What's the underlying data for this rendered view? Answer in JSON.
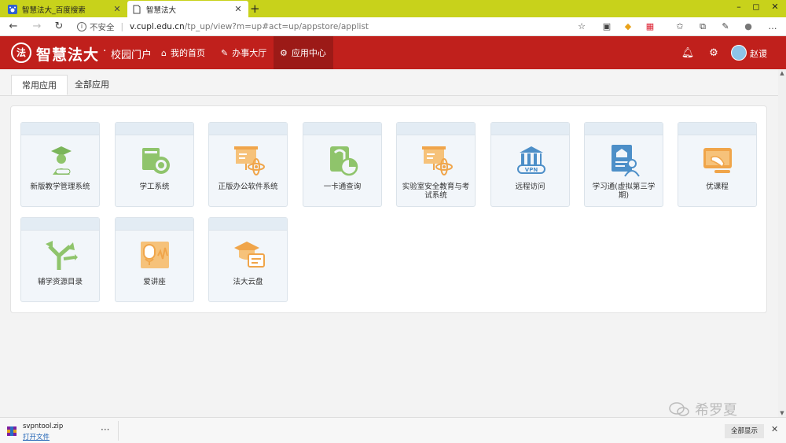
{
  "browser": {
    "tabs": [
      {
        "title": "智慧法大_百度搜索"
      },
      {
        "title": "智慧法大"
      }
    ],
    "new_tab_label": "+",
    "window_controls": {
      "minimize": "–",
      "maximize": "◻",
      "close": "✕"
    },
    "security_label": "不安全",
    "url_host": "v.cupl.edu.cn",
    "url_path": "/tp_up/view?m=up#act=up/appstore/applist"
  },
  "header": {
    "logo_glyph": "法",
    "brand": "智慧法大",
    "dot": "·",
    "subtitle": "校园门户",
    "nav": [
      {
        "label": "我的首页",
        "icon": "home-icon"
      },
      {
        "label": "办事大厅",
        "icon": "edit-icon"
      },
      {
        "label": "应用中心",
        "icon": "apps-icon"
      }
    ],
    "username": "赵谡"
  },
  "tabs": {
    "common": "常用应用",
    "all": "全部应用"
  },
  "apps": [
    {
      "label": "新版教学管理系统",
      "icon": "graduate-icon"
    },
    {
      "label": "学工系统",
      "icon": "student-affairs-icon"
    },
    {
      "label": "正版办公软件系统",
      "icon": "presentation-atom-icon"
    },
    {
      "label": "一卡通查询",
      "icon": "card-query-icon"
    },
    {
      "label": "实验室安全教育与考试系统",
      "icon": "lab-safety-icon"
    },
    {
      "label": "远程访问",
      "icon": "vpn-icon"
    },
    {
      "label": "学习通(虚拟第三学期)",
      "icon": "learning-icon"
    },
    {
      "label": "优课程",
      "icon": "course-icon"
    },
    {
      "label": "辅学资源目录",
      "icon": "directions-icon"
    },
    {
      "label": "爱讲座",
      "icon": "lecture-icon"
    },
    {
      "label": "法大云盘",
      "icon": "cloud-disk-icon"
    }
  ],
  "watermark": "希罗夏",
  "downloads": {
    "file_name": "svpntool.zip",
    "open_label": "打开文件",
    "more_label": "···",
    "show_all": "全部显示",
    "close": "✕"
  },
  "colors": {
    "accent": "#c0201c",
    "accent_dark": "#9c1a17",
    "tabstrip": "#c8d21b",
    "icon_green": "#8fc46b",
    "icon_orange": "#f0a54a",
    "icon_blue": "#4d8fc8"
  }
}
